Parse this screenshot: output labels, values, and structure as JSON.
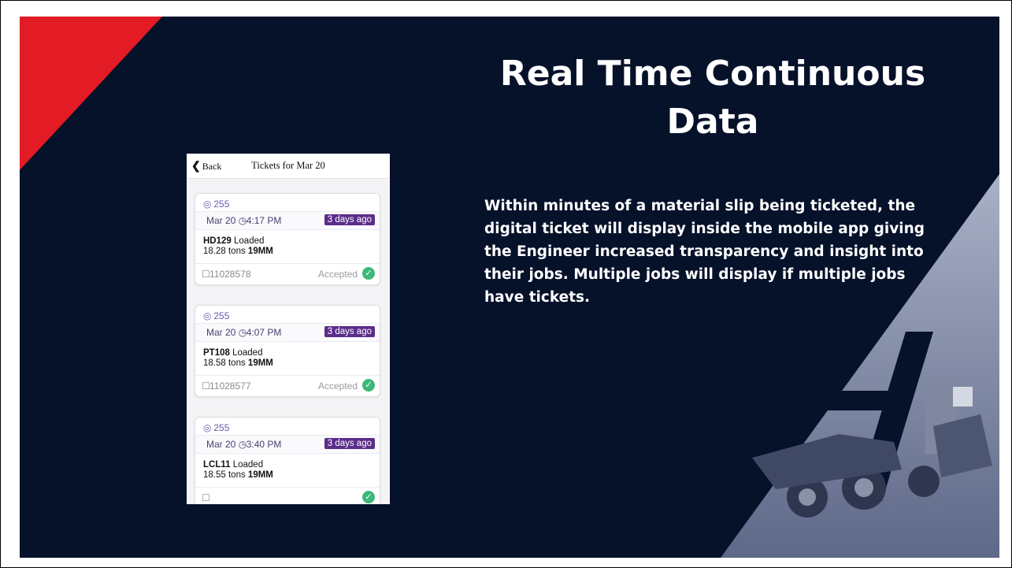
{
  "slide": {
    "title": "Real Time Continuous Data",
    "body": "Within minutes of a material slip being ticketed, the digital ticket will display inside the mobile app giving the Engineer increased transparency and insight into their jobs. Multiple jobs will display if multiple jobs have tickets.",
    "colors": {
      "background": "#06112a",
      "accent": "#e21b24",
      "text": "#ffffff"
    }
  },
  "phone": {
    "back_label": "Back",
    "header_title": "Tickets for Mar 20",
    "tickets": [
      {
        "site": "255",
        "date": "Mar 20",
        "time": "4:17 PM",
        "age": "3 days ago",
        "truck": "HD129",
        "status_word": "Loaded",
        "tons": "18.28 tons",
        "material": "19MM",
        "ticket_no": "11028578",
        "state": "Accepted"
      },
      {
        "site": "255",
        "date": "Mar 20",
        "time": "4:07 PM",
        "age": "3 days ago",
        "truck": "PT108",
        "status_word": "Loaded",
        "tons": "18.58 tons",
        "material": "19MM",
        "ticket_no": "11028577",
        "state": "Accepted"
      },
      {
        "site": "255",
        "date": "Mar 20",
        "time": "3:40 PM",
        "age": "3 days ago",
        "truck": "LCL11",
        "status_word": "Loaded",
        "tons": "18.55 tons",
        "material": "19MM",
        "ticket_no": "",
        "state": ""
      }
    ],
    "icons": {
      "site": "location-pin-icon",
      "time": "clock-icon",
      "ticket": "bookmark-icon",
      "state": "check-circle-icon"
    }
  }
}
